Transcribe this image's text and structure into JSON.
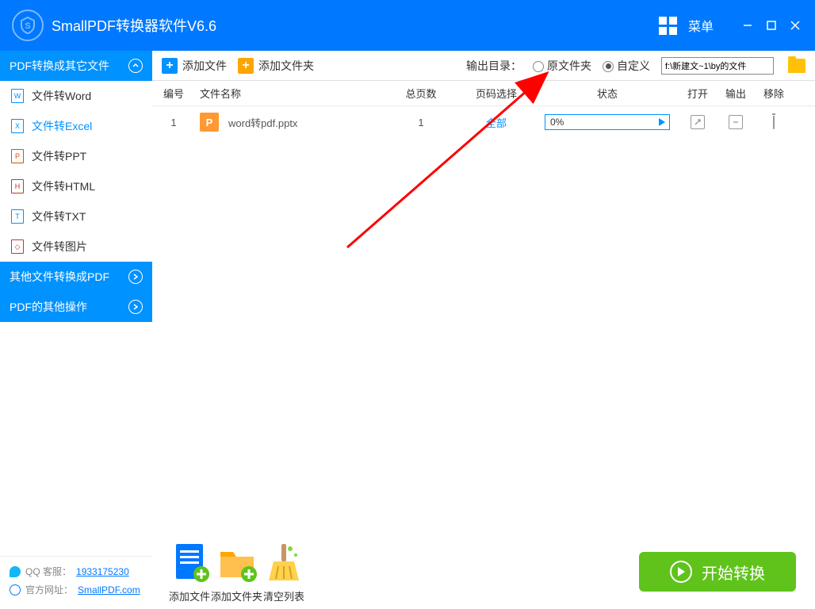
{
  "titlebar": {
    "title": "SmallPDF转换器软件V6.6",
    "menu": "菜单"
  },
  "sidebar": {
    "section1": "PDF转换成其它文件",
    "items": [
      {
        "label": "文件转Word",
        "glyph": "W"
      },
      {
        "label": "文件转Excel",
        "glyph": "X"
      },
      {
        "label": "文件转PPT",
        "glyph": "P"
      },
      {
        "label": "文件转HTML",
        "glyph": "H"
      },
      {
        "label": "文件转TXT",
        "glyph": "T"
      },
      {
        "label": "文件转图片",
        "glyph": "◇"
      }
    ],
    "section2": "其他文件转换成PDF",
    "section3": "PDF的其他操作",
    "footer": {
      "qq_label": "QQ 客服：",
      "qq_value": "1933175230",
      "site_label": "官方网址：",
      "site_value": "SmallPDF.com"
    }
  },
  "toolbar": {
    "add_file": "添加文件",
    "add_folder": "添加文件夹",
    "output_label": "输出目录：",
    "radio_original": "原文件夹",
    "radio_custom": "自定义",
    "path": "f:\\新建文~1\\by的文件"
  },
  "table": {
    "headers": {
      "num": "编号",
      "name": "文件名称",
      "pages": "总页数",
      "sel": "页码选择",
      "status": "状态",
      "open": "打开",
      "out": "输出",
      "del": "移除"
    },
    "rows": [
      {
        "num": "1",
        "icon": "P",
        "name": "word转pdf.pptx",
        "pages": "1",
        "sel": "全部",
        "progress": "0%"
      }
    ]
  },
  "bottom": {
    "add_file": "添加文件",
    "add_folder": "添加文件夹",
    "clear": "清空列表",
    "start": "开始转换"
  }
}
